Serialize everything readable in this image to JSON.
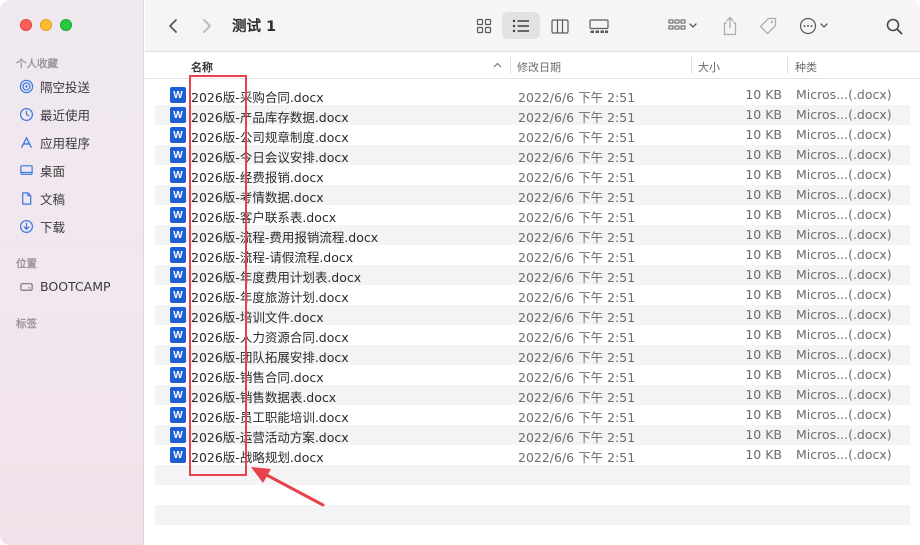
{
  "window": {
    "title": "测试 1"
  },
  "sidebar": {
    "favorites_label": "个人收藏",
    "favorites": [
      {
        "label": "隔空投送",
        "icon": "airdrop-icon"
      },
      {
        "label": "最近使用",
        "icon": "clock-icon"
      },
      {
        "label": "应用程序",
        "icon": "applications-icon"
      },
      {
        "label": "桌面",
        "icon": "desktop-icon"
      },
      {
        "label": "文稿",
        "icon": "document-icon"
      },
      {
        "label": "下载",
        "icon": "download-icon"
      }
    ],
    "locations_label": "位置",
    "locations": [
      {
        "label": "BOOTCAMP",
        "icon": "disk-icon"
      }
    ],
    "tags_label": "标签"
  },
  "columns": {
    "name": "名称",
    "date": "修改日期",
    "size": "大小",
    "kind": "种类"
  },
  "files": [
    {
      "name": "2026版-采购合同.docx",
      "date": "2022/6/6 下午 2:51",
      "size": "10 KB",
      "kind": "Micros...(.docx)"
    },
    {
      "name": "2026版-产品库存数据.docx",
      "date": "2022/6/6 下午 2:51",
      "size": "10 KB",
      "kind": "Micros...(.docx)"
    },
    {
      "name": "2026版-公司规章制度.docx",
      "date": "2022/6/6 下午 2:51",
      "size": "10 KB",
      "kind": "Micros...(.docx)"
    },
    {
      "name": "2026版-今日会议安排.docx",
      "date": "2022/6/6 下午 2:51",
      "size": "10 KB",
      "kind": "Micros...(.docx)"
    },
    {
      "name": "2026版-经费报销.docx",
      "date": "2022/6/6 下午 2:51",
      "size": "10 KB",
      "kind": "Micros...(.docx)"
    },
    {
      "name": "2026版-考情数据.docx",
      "date": "2022/6/6 下午 2:51",
      "size": "10 KB",
      "kind": "Micros...(.docx)"
    },
    {
      "name": "2026版-客户联系表.docx",
      "date": "2022/6/6 下午 2:51",
      "size": "10 KB",
      "kind": "Micros...(.docx)"
    },
    {
      "name": "2026版-流程-费用报销流程.docx",
      "date": "2022/6/6 下午 2:51",
      "size": "10 KB",
      "kind": "Micros...(.docx)"
    },
    {
      "name": "2026版-流程-请假流程.docx",
      "date": "2022/6/6 下午 2:51",
      "size": "10 KB",
      "kind": "Micros...(.docx)"
    },
    {
      "name": "2026版-年度费用计划表.docx",
      "date": "2022/6/6 下午 2:51",
      "size": "10 KB",
      "kind": "Micros...(.docx)"
    },
    {
      "name": "2026版-年度旅游计划.docx",
      "date": "2022/6/6 下午 2:51",
      "size": "10 KB",
      "kind": "Micros...(.docx)"
    },
    {
      "name": "2026版-培训文件.docx",
      "date": "2022/6/6 下午 2:51",
      "size": "10 KB",
      "kind": "Micros...(.docx)"
    },
    {
      "name": "2026版-人力资源合同.docx",
      "date": "2022/6/6 下午 2:51",
      "size": "10 KB",
      "kind": "Micros...(.docx)"
    },
    {
      "name": "2026版-团队拓展安排.docx",
      "date": "2022/6/6 下午 2:51",
      "size": "10 KB",
      "kind": "Micros...(.docx)"
    },
    {
      "name": "2026版-销售合同.docx",
      "date": "2022/6/6 下午 2:51",
      "size": "10 KB",
      "kind": "Micros...(.docx)"
    },
    {
      "name": "2026版-销售数据表.docx",
      "date": "2022/6/6 下午 2:51",
      "size": "10 KB",
      "kind": "Micros...(.docx)"
    },
    {
      "name": "2026版-员工职能培训.docx",
      "date": "2022/6/6 下午 2:51",
      "size": "10 KB",
      "kind": "Micros...(.docx)"
    },
    {
      "name": "2026版-运营活动方案.docx",
      "date": "2022/6/6 下午 2:51",
      "size": "10 KB",
      "kind": "Micros...(.docx)"
    },
    {
      "name": "2026版-战略规划.docx",
      "date": "2022/6/6 下午 2:51",
      "size": "10 KB",
      "kind": "Micros...(.docx)"
    }
  ],
  "file_icon_letter": "W",
  "colors": {
    "accent": "#1f5fd6",
    "annotation": "#e8434c"
  }
}
